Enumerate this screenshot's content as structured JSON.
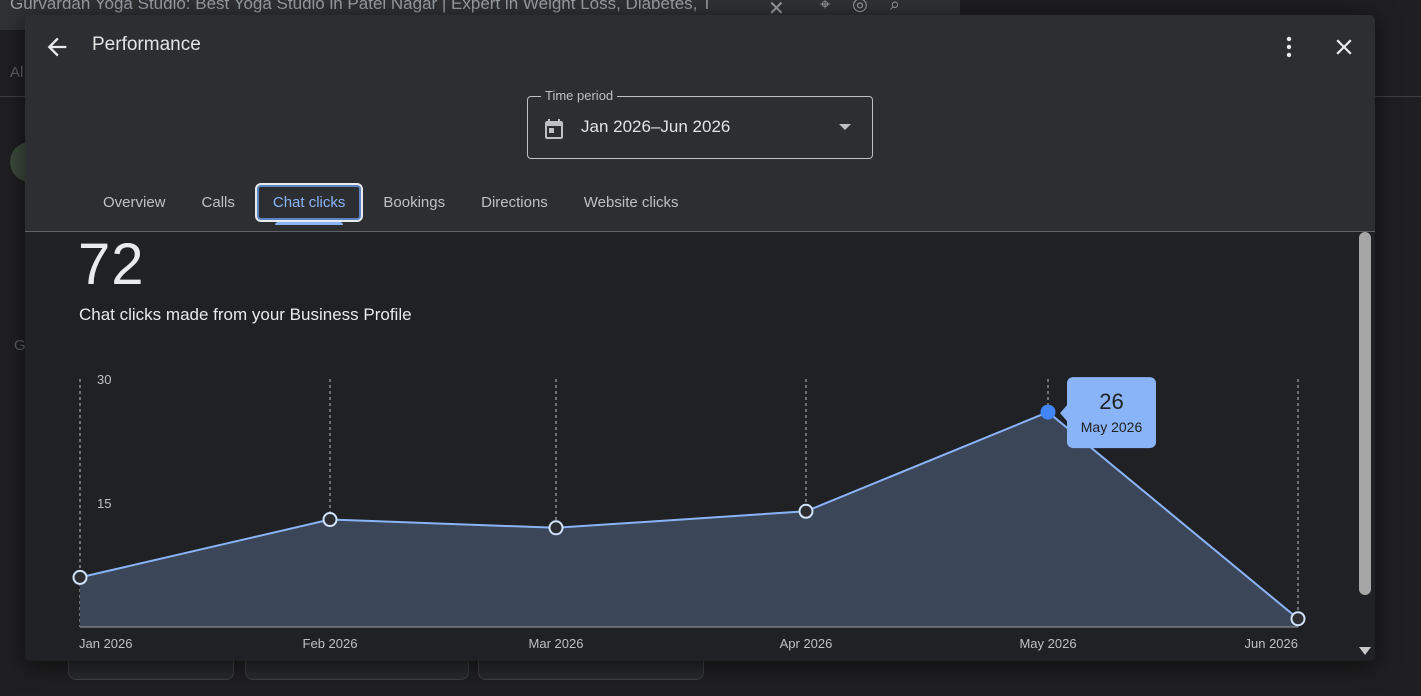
{
  "background": {
    "tab_title": "Gurvardan Yoga Studio: Best Yoga Studio in Patel Nagar | Expert in Weight Loss, Diabetes, T",
    "letter_a": "Al",
    "letter_g": "G"
  },
  "dialog": {
    "title": "Performance",
    "back_icon": "arrow-back-icon",
    "more_icon": "more-vert-icon",
    "close_icon": "close-icon"
  },
  "period": {
    "label": "Time period",
    "value": "Jan 2026–Jun 2026",
    "icon": "calendar-icon"
  },
  "tabs": [
    {
      "label": "Overview",
      "active": false
    },
    {
      "label": "Calls",
      "active": false
    },
    {
      "label": "Chat clicks",
      "active": true
    },
    {
      "label": "Bookings",
      "active": false
    },
    {
      "label": "Directions",
      "active": false
    },
    {
      "label": "Website clicks",
      "active": false
    }
  ],
  "summary": {
    "total": "72",
    "description": "Chat clicks made from your Business Profile"
  },
  "chart_data": {
    "type": "area",
    "categories": [
      "Jan 2026",
      "Feb 2026",
      "Mar 2026",
      "Apr 2026",
      "May 2026",
      "Jun 2026"
    ],
    "values": [
      6,
      13,
      12,
      14,
      26,
      1
    ],
    "y_ticks": [
      30,
      15
    ],
    "ylim": [
      0,
      30
    ],
    "highlighted_index": 4,
    "tooltip": {
      "value": "26",
      "label": "May 2026"
    },
    "line_color": "#8ab4f8",
    "fill_color": "#3b4659",
    "highlight_color": "#4285f4"
  }
}
